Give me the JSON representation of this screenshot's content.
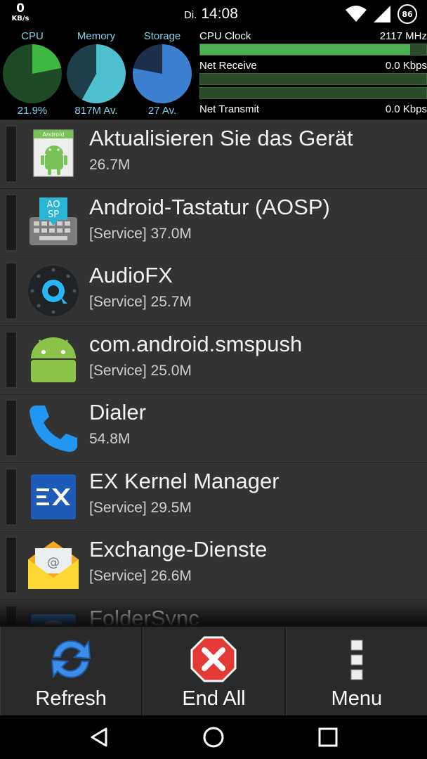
{
  "status_bar": {
    "net_speed_value": "0",
    "net_speed_unit": "KB/s",
    "day": "Di.",
    "time": "14:08",
    "battery": "86",
    "icons": [
      "wifi-icon",
      "cellular-signal-icon",
      "battery-icon"
    ]
  },
  "stats": {
    "cpu": {
      "label": "CPU",
      "value": "21.9%",
      "fraction": 0.219
    },
    "memory": {
      "label": "Memory",
      "value": "817M Av.",
      "fraction": 0.58
    },
    "storage": {
      "label": "Storage",
      "value": "27 Av.",
      "fraction": 0.78
    },
    "cpu_clock": {
      "label": "CPU Clock",
      "value": "2117 MHz",
      "fraction": 0.93
    },
    "net_receive": {
      "label": "Net Receive",
      "value": "0.0 Kbps",
      "fraction": 0
    },
    "net_transmit": {
      "label": "Net Transmit",
      "value": "0.0 Kbps",
      "fraction": 0
    },
    "colors": {
      "gauge_fill_cpu": "#3db843",
      "gauge_fill_memory": "#4fc0d0",
      "gauge_fill_storage": "#3d7fd0",
      "label": "#7fd0ee",
      "bar_fill": "#4caf50"
    }
  },
  "apps": [
    {
      "name": "Aktualisieren Sie das Gerät",
      "memory": "26.7M",
      "icon": "android-update-icon"
    },
    {
      "name": "Android-Tastatur (AOSP)",
      "memory": "[Service] 37.0M",
      "icon": "keyboard-aosp-icon"
    },
    {
      "name": "AudioFX",
      "memory": "[Service] 25.7M",
      "icon": "audiofx-icon"
    },
    {
      "name": "com.android.smspush",
      "memory": "[Service] 25.0M",
      "icon": "android-robot-icon"
    },
    {
      "name": "Dialer",
      "memory": "54.8M",
      "icon": "phone-icon"
    },
    {
      "name": "EX Kernel Manager",
      "memory": "[Service] 29.5M",
      "icon": "ex-kernel-icon"
    },
    {
      "name": "Exchange-Dienste",
      "memory": "[Service] 26.6M",
      "icon": "email-envelope-icon"
    },
    {
      "name": "FolderSync",
      "memory": "",
      "icon": "foldersync-icon"
    }
  ],
  "actions": {
    "refresh": "Refresh",
    "end_all": "End All",
    "menu": "Menu"
  },
  "navigation": {
    "icons": [
      "back-icon",
      "home-icon",
      "recents-icon"
    ]
  }
}
